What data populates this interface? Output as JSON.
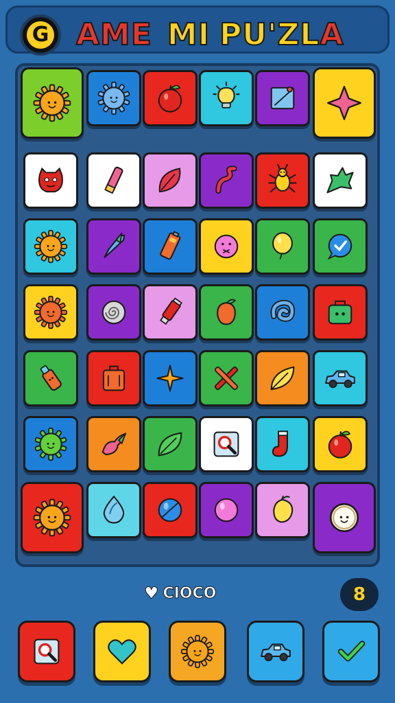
{
  "header": {
    "logo_letter": "G",
    "title_part1": "AME",
    "title_part2": "MI",
    "title_part3": "PU'ZL",
    "title_part3_last": "A"
  },
  "board": {
    "tiles": [
      {
        "row": 0,
        "col": 0,
        "color": "#7ccf2a",
        "icon": "sun-face-icon",
        "big": true
      },
      {
        "row": 0,
        "col": 1,
        "color": "#1e7fd8",
        "icon": "blue-gear-face-icon"
      },
      {
        "row": 0,
        "col": 2,
        "color": "#e8271f",
        "icon": "apple-icon"
      },
      {
        "row": 0,
        "col": 3,
        "color": "#2fc8e0",
        "icon": "lightbulb-icon"
      },
      {
        "row": 0,
        "col": 4,
        "color": "#8a2bc9",
        "icon": "picture-frame-icon"
      },
      {
        "row": 0,
        "col": 5,
        "color": "#ffd21f",
        "icon": "pink-star-icon",
        "big": true
      },
      {
        "row": 1,
        "col": 0,
        "color": "#ffffff",
        "icon": "red-monster-icon"
      },
      {
        "row": 1,
        "col": 1,
        "color": "#ffffff",
        "icon": "pink-crayon-icon"
      },
      {
        "row": 1,
        "col": 2,
        "color": "#e79ae8",
        "icon": "red-leaf-icon"
      },
      {
        "row": 1,
        "col": 3,
        "color": "#8a2bc9",
        "icon": "red-swirl-icon"
      },
      {
        "row": 1,
        "col": 4,
        "color": "#e8271f",
        "icon": "bug-icon"
      },
      {
        "row": 1,
        "col": 5,
        "color": "#ffffff",
        "icon": "green-leaf-icon"
      },
      {
        "row": 2,
        "col": 0,
        "color": "#2fc8e0",
        "icon": "sun-face-icon"
      },
      {
        "row": 2,
        "col": 1,
        "color": "#8a2bc9",
        "icon": "blue-rocket-icon"
      },
      {
        "row": 2,
        "col": 2,
        "color": "#1e7fd8",
        "icon": "battery-icon"
      },
      {
        "row": 2,
        "col": 3,
        "color": "#ffd21f",
        "icon": "pink-ball-face-icon"
      },
      {
        "row": 2,
        "col": 4,
        "color": "#39b54a",
        "icon": "yellow-balloon-icon"
      },
      {
        "row": 2,
        "col": 5,
        "color": "#39b54a",
        "icon": "chat-bubble-icon"
      },
      {
        "row": 3,
        "col": 0,
        "color": "#ffd21f",
        "icon": "orange-gear-face-icon"
      },
      {
        "row": 3,
        "col": 1,
        "color": "#8a2bc9",
        "icon": "spiral-shell-icon"
      },
      {
        "row": 3,
        "col": 2,
        "color": "#e79ae8",
        "icon": "paint-tube-icon"
      },
      {
        "row": 3,
        "col": 3,
        "color": "#39b54a",
        "icon": "orange-fruit-icon"
      },
      {
        "row": 3,
        "col": 4,
        "color": "#1e7fd8",
        "icon": "blue-swirl-icon"
      },
      {
        "row": 3,
        "col": 5,
        "color": "#e8271f",
        "icon": "green-bag-icon"
      },
      {
        "row": 4,
        "col": 0,
        "color": "#39b54a",
        "icon": "bottle-icon"
      },
      {
        "row": 4,
        "col": 1,
        "color": "#e8271f",
        "icon": "suitcase-icon"
      },
      {
        "row": 4,
        "col": 2,
        "color": "#1e7fd8",
        "icon": "orange-star-icon"
      },
      {
        "row": 4,
        "col": 3,
        "color": "#39b54a",
        "icon": "crossed-crayons-icon"
      },
      {
        "row": 4,
        "col": 4,
        "color": "#f58c1f",
        "icon": "yellow-leaf-icon"
      },
      {
        "row": 4,
        "col": 5,
        "color": "#2fc8e0",
        "icon": "car-icon"
      },
      {
        "row": 5,
        "col": 0,
        "color": "#1e7fd8",
        "icon": "green-virus-face-icon"
      },
      {
        "row": 5,
        "col": 1,
        "color": "#f58c1f",
        "icon": "pink-flower-icon"
      },
      {
        "row": 5,
        "col": 2,
        "color": "#39b54a",
        "icon": "leaf-icon"
      },
      {
        "row": 5,
        "col": 3,
        "color": "#ffffff",
        "icon": "magnifier-icon"
      },
      {
        "row": 5,
        "col": 4,
        "color": "#2fc8e0",
        "icon": "red-sock-icon"
      },
      {
        "row": 5,
        "col": 5,
        "color": "#ffd21f",
        "icon": "red-apple-icon"
      },
      {
        "row": 6,
        "col": 0,
        "color": "#e8271f",
        "icon": "sun-face-icon",
        "big": true
      },
      {
        "row": 6,
        "col": 1,
        "color": "#5fd6e8",
        "icon": "water-drop-icon"
      },
      {
        "row": 6,
        "col": 2,
        "color": "#e8271f",
        "icon": "blue-ball-icon"
      },
      {
        "row": 6,
        "col": 3,
        "color": "#8a2bc9",
        "icon": "pink-ball-icon"
      },
      {
        "row": 6,
        "col": 4,
        "color": "#e79ae8",
        "icon": "lemon-icon"
      },
      {
        "row": 6,
        "col": 5,
        "color": "#8a2bc9",
        "icon": "smiley-coin-icon",
        "big": true
      }
    ]
  },
  "footer": {
    "hint_label": "CIOCO",
    "counter": "8",
    "tools": [
      {
        "name": "magnifier-tool",
        "color": "#e8271f",
        "icon": "magnifier-icon"
      },
      {
        "name": "heart-tool",
        "color": "#ffd21f",
        "icon": "heart-icon"
      },
      {
        "name": "sun-tool",
        "color": "#f5a623",
        "icon": "sun-face-icon"
      },
      {
        "name": "car-tool",
        "color": "#2fa9e8",
        "icon": "car-icon"
      },
      {
        "name": "check-tool",
        "color": "#2fa9e8",
        "icon": "check-icon"
      }
    ]
  }
}
